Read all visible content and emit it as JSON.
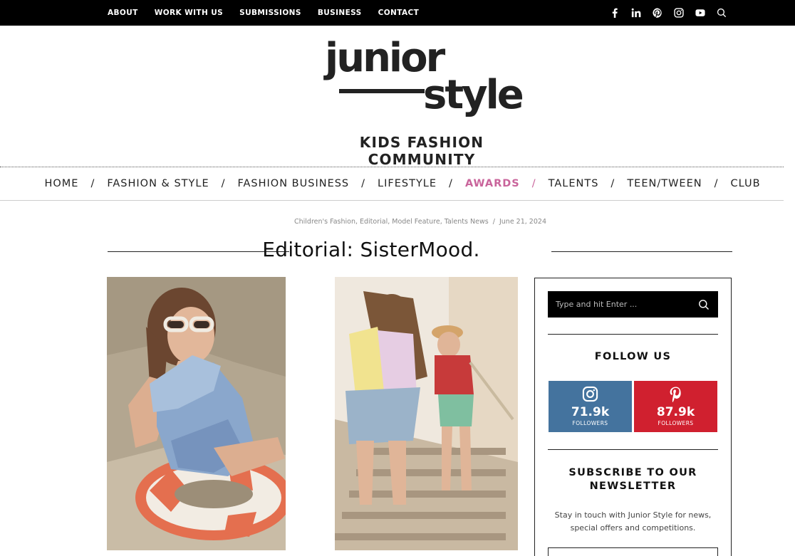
{
  "topbar": {
    "links": [
      "ABOUT",
      "WORK WITH US",
      "SUBMISSIONS",
      "BUSINESS",
      "CONTACT"
    ],
    "social_icons": [
      "facebook-icon",
      "linkedin-icon",
      "pinterest-icon",
      "instagram-icon",
      "youtube-icon",
      "search-icon"
    ]
  },
  "logo": {
    "word1": "junior",
    "word2": "style",
    "tagline": "KIDS FASHION COMMUNITY"
  },
  "nav": {
    "items": [
      "HOME",
      "FASHION & STYLE",
      "FASHION BUSINESS",
      "LIFESTYLE",
      "AWARDS",
      "TALENTS",
      "TEEN/TWEEN",
      "CLUB"
    ],
    "separator": "/",
    "active": "AWARDS",
    "active_color": "#c9649b"
  },
  "article": {
    "categories": "Children's Fashion, Editorial, Model Feature, Talents News",
    "date": "June 21, 2024",
    "title": "Editorial: SisterMood."
  },
  "sidebar": {
    "search_placeholder": "Type and hit Enter ...",
    "follow_heading": "FOLLOW US",
    "instagram": {
      "count": "71.9k",
      "label": "FOLLOWERS",
      "color": "#44739e"
    },
    "pinterest": {
      "count": "87.9k",
      "label": "FOLLOWERS",
      "color": "#d0202f"
    },
    "newsletter_heading_line1": "SUBSCRIBE TO OUR",
    "newsletter_heading_line2": "NEWSLETTER",
    "newsletter_text_line1": "Stay in touch with Junior Style for news,",
    "newsletter_text_line2": "special offers and competitions."
  }
}
